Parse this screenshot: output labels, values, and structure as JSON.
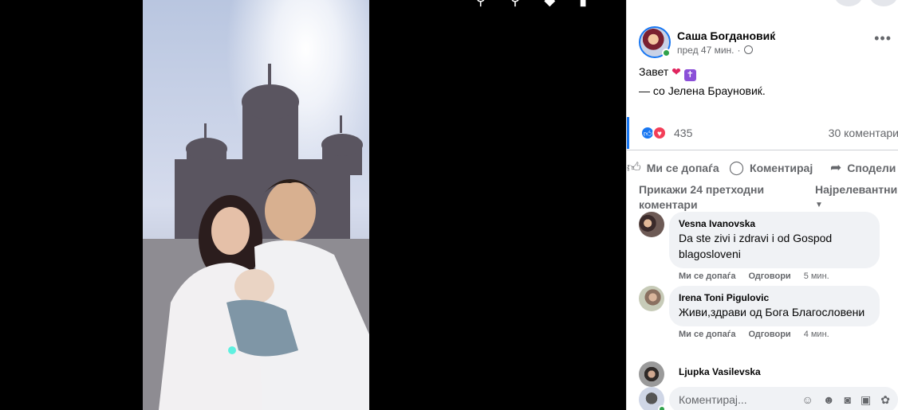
{
  "viewer": {
    "tools": [
      "search-icon",
      "zoom-out-icon",
      "tag-icon",
      "more-icon"
    ]
  },
  "post": {
    "author": "Саша Богдановиќ",
    "time": "пред 47 мин.",
    "caption": "Завет",
    "with_prefix": "— со",
    "with_name": "Јелена Брауновиќ",
    "with_suffix": ".",
    "reaction_count": "435",
    "comment_count": "30 коментари"
  },
  "actions": {
    "like": "Ми се допаѓа",
    "comment": "Коментирај",
    "share": "Сподели"
  },
  "comments_header": {
    "previous": "Прикажи 24 претходни коментари",
    "sort": "Најрелевантни"
  },
  "comments": [
    {
      "name": "Vesna Ivanovska",
      "text": "Da ste zivi i zdravi i od Gospod blagosloveni",
      "like": "Ми се допаѓа",
      "reply": "Одговори",
      "time": "5 мин."
    },
    {
      "name": "Irena Toni Pigulovic",
      "text": "Живи,здрави од Бога Благословени",
      "like": "Ми се допаѓа",
      "reply": "Одговори",
      "time": "4 мин."
    },
    {
      "name": "Ljupka Vasilevska"
    }
  ],
  "composer": {
    "placeholder": "Коментирај..."
  },
  "colors": {
    "accent": "#1877f2",
    "online": "#31a24c",
    "love": "#f33e58"
  }
}
